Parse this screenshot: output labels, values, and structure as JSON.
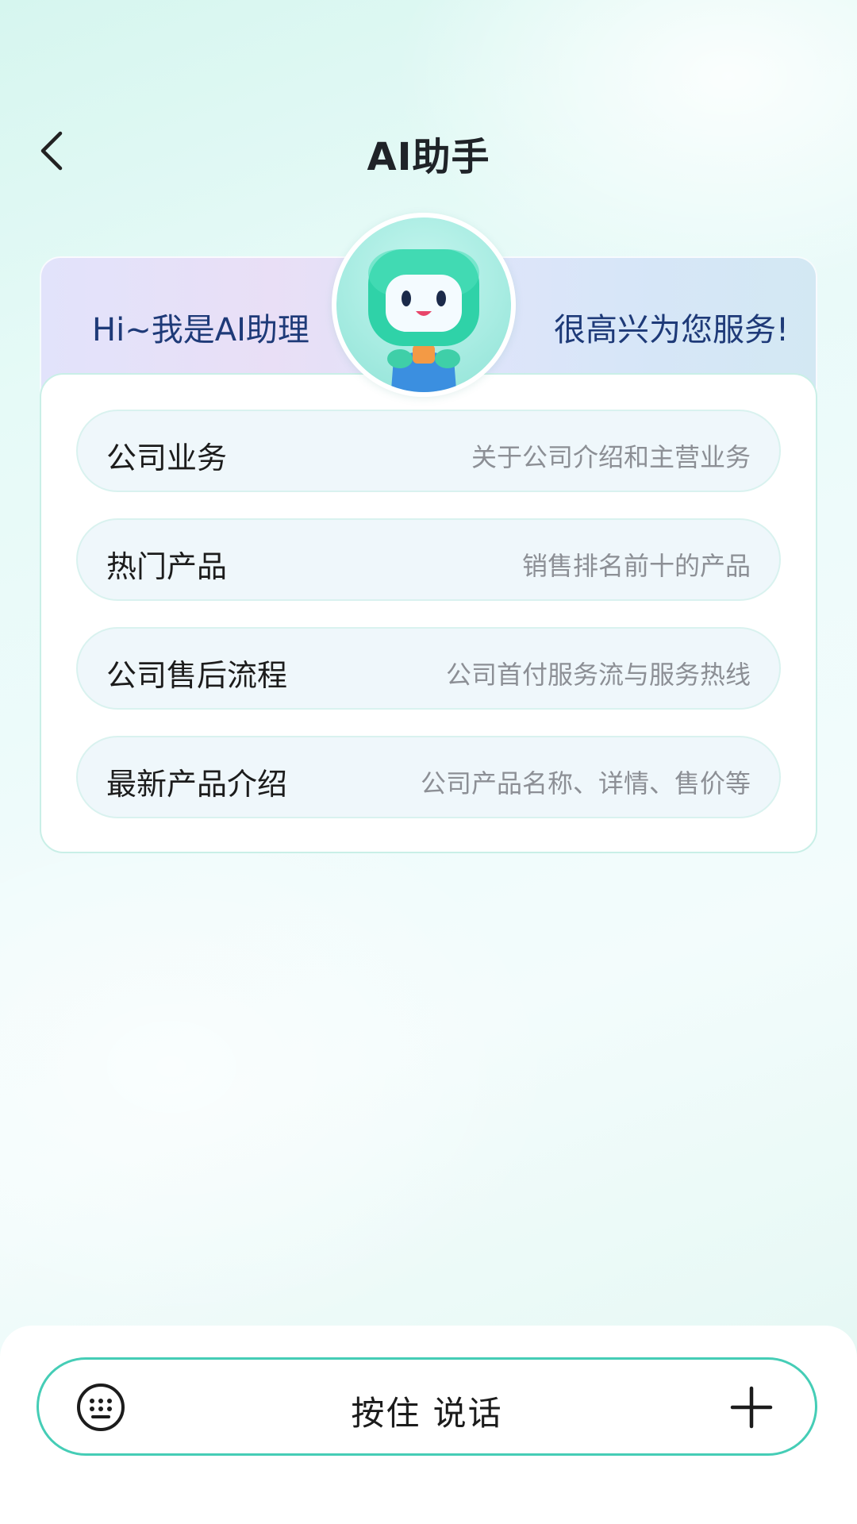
{
  "header": {
    "title": "AI助手",
    "back_icon": "chevron-left-icon"
  },
  "banner": {
    "greeting_left": "Hi~我是AI助理",
    "greeting_right": "很高兴为您服务!",
    "avatar_icon": "robot-mascot-icon"
  },
  "menu": {
    "items": [
      {
        "title": "公司业务",
        "desc": "关于公司介绍和主营业务"
      },
      {
        "title": "热门产品",
        "desc": "销售排名前十的产品"
      },
      {
        "title": "公司售后流程",
        "desc": "公司首付服务流与服务热线"
      },
      {
        "title": "最新产品介绍",
        "desc": "公司产品名称、详情、售价等"
      }
    ]
  },
  "input_bar": {
    "voice_label": "按住 说话",
    "keyboard_icon": "keyboard-icon",
    "plus_icon": "plus-icon"
  },
  "colors": {
    "accent": "#45cdb6",
    "greeting_text": "#1e3a78",
    "menu_item_bg": "#eff7fb"
  }
}
